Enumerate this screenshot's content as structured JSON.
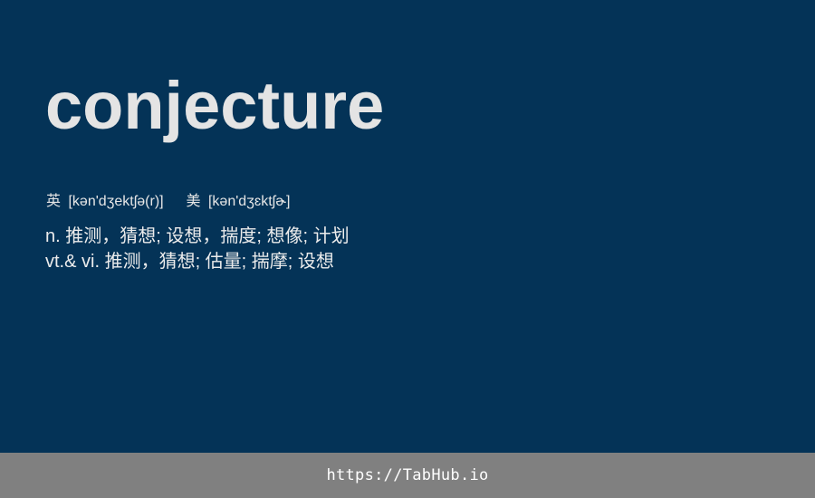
{
  "card": {
    "word": "conjecture",
    "phonetics": {
      "uk_label": "英",
      "uk_ipa": "[kən'dʒektʃə(r)]",
      "us_label": "美",
      "us_ipa": "[kən'dʒɛktʃɚ]"
    },
    "definitions": [
      "n. 推测，猜想; 设想，揣度; 想像; 计划",
      "vt.& vi. 推测，猜想; 估量; 揣摩; 设想"
    ]
  },
  "footer": {
    "link_text": "https://TabHub.io"
  },
  "colors": {
    "background": "#043357",
    "word_text": "#e4e4e4",
    "footer_bar": "#808080",
    "footer_text": "#ffffff"
  }
}
